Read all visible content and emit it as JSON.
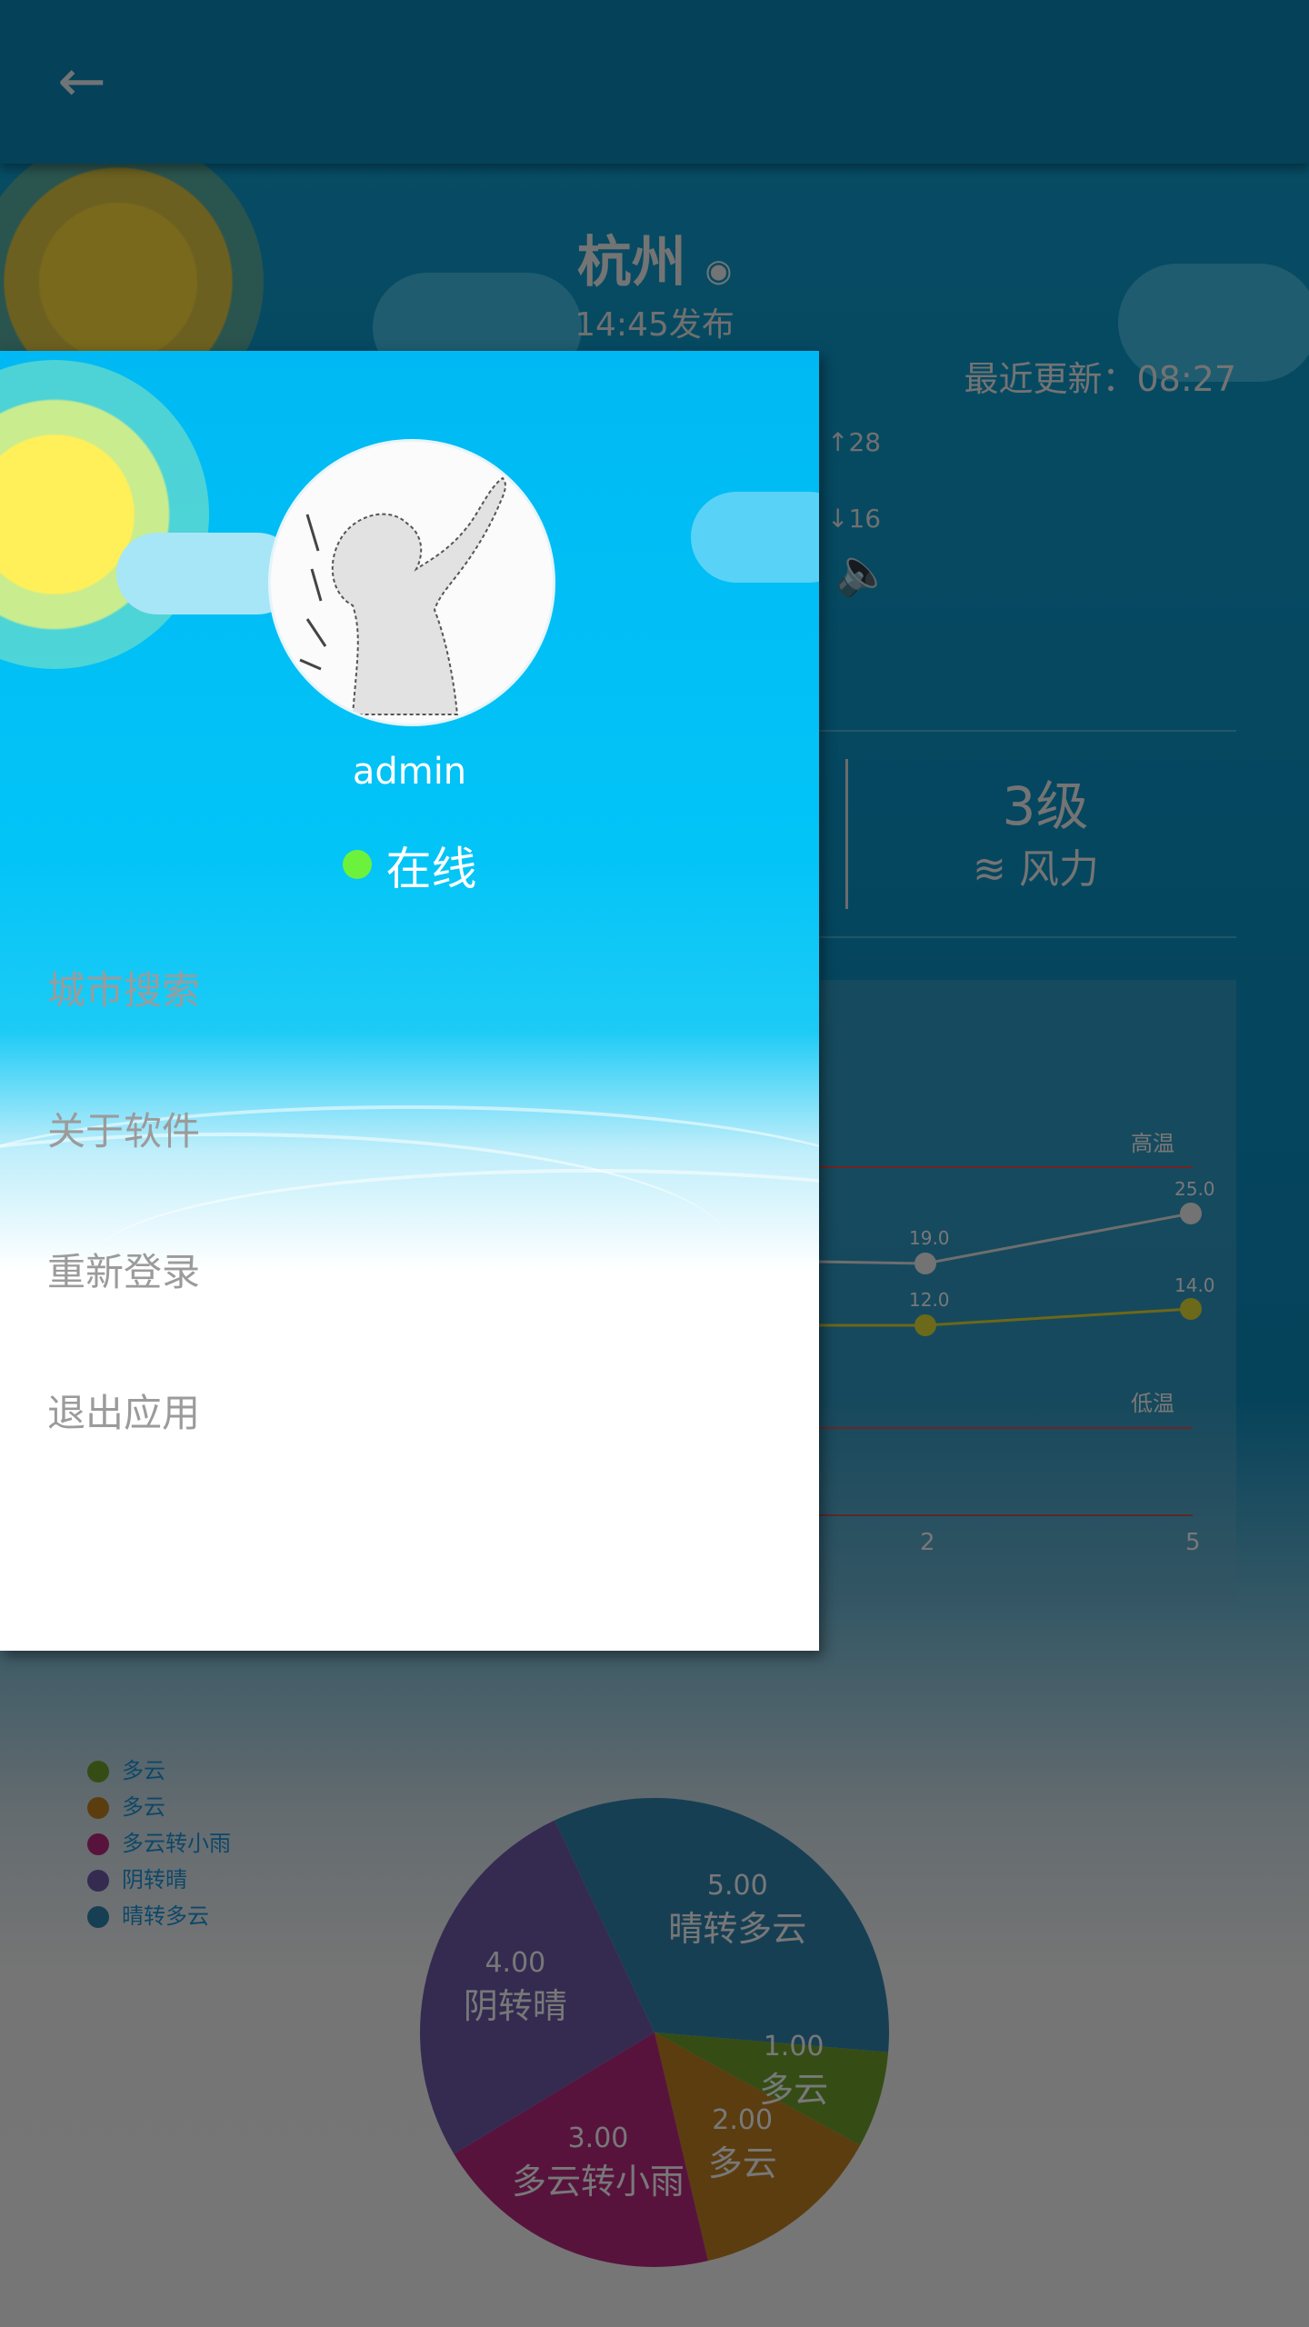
{
  "toolbar": {
    "back_icon": "arrow-left-icon"
  },
  "weather": {
    "city": "杭州",
    "published": "14:45发布",
    "recent_update": "最近更新：08:27",
    "temp_high": "28",
    "temp_low": "16",
    "wind_level": "3级",
    "wind_label": "风力"
  },
  "trend_chart": {
    "high_label": "高温",
    "low_label": "低温",
    "high_values": [
      "19.0",
      "25.0"
    ],
    "low_values": [
      "12.0",
      "14.0"
    ],
    "x_ticks": [
      "2",
      "5"
    ]
  },
  "pie_legend": [
    {
      "label": "多云",
      "color": "#6a9a2a"
    },
    {
      "label": "多云",
      "color": "#b97a1e"
    },
    {
      "label": "多云转小雨",
      "color": "#b0267a"
    },
    {
      "label": "阴转晴",
      "color": "#6a57a3"
    },
    {
      "label": "晴转多云",
      "color": "#2e7ea8"
    }
  ],
  "chart_data": {
    "type": "pie",
    "slices": [
      {
        "name": "晴转多云",
        "value": 5.0,
        "label": "5.00",
        "color": "#2e7ea8"
      },
      {
        "name": "多云",
        "value": 1.0,
        "label": "1.00",
        "color": "#6a9a2a"
      },
      {
        "name": "多云",
        "value": 2.0,
        "label": "2.00",
        "color": "#b97a1e"
      },
      {
        "name": "多云转小雨",
        "value": 3.0,
        "label": "3.00",
        "color": "#b0267a"
      },
      {
        "name": "阴转晴",
        "value": 4.0,
        "label": "4.00",
        "color": "#6a57a3"
      }
    ]
  },
  "drawer": {
    "username": "admin",
    "status": "在线",
    "menu": [
      "城市搜索",
      "关于软件",
      "重新登录",
      "退出应用"
    ]
  }
}
